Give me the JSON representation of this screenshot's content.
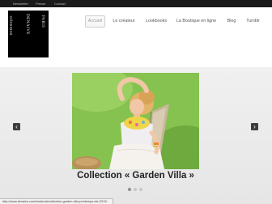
{
  "topbar": {
    "links": [
      "Newsletter",
      "Presse",
      "Contact"
    ]
  },
  "logo": {
    "left_text": "DOMINIQUE",
    "mid_text": "DENAIVE",
    "right_text": "PARIS"
  },
  "nav": {
    "items": [
      "Accueil",
      "Le créateur",
      "Lookbooks",
      "La Boutique en ligne",
      "Blog",
      "Tumblr"
    ],
    "active": "Accueil"
  },
  "slider": {
    "caption": "Collection « Garden Villa »",
    "prev_symbol": "‹",
    "next_symbol": "›",
    "slide_count": 3,
    "active_slide": 1
  },
  "status": {
    "url": "http://www.denaive.com/lookbook/collection-garden-villa-printemps-ete-2013/"
  },
  "colors": {
    "topbar": "#1b1b1b",
    "logo_bg": "#000000",
    "arrow_bg": "#3d3d3d",
    "grass": "#7fbf46"
  }
}
